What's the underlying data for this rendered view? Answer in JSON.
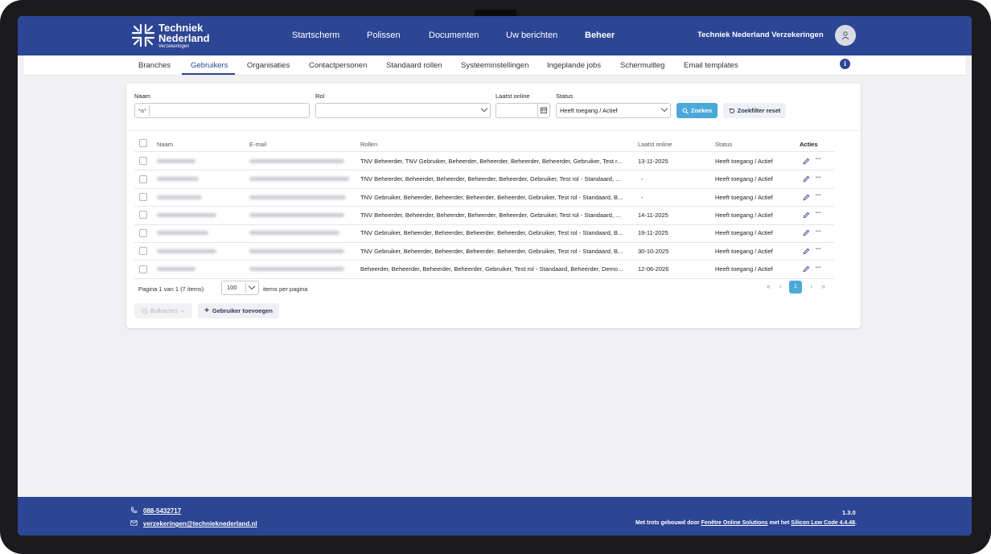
{
  "brand": {
    "line1": "Techniek",
    "line2": "Nederland",
    "line3": "Verzekeringen"
  },
  "mainnav": [
    "Startscherm",
    "Polissen",
    "Documenten",
    "Uw berichten",
    "Beheer"
  ],
  "org_name": "Techniek Nederland Verzekeringen",
  "subnav": [
    "Branches",
    "Gebruikers",
    "Organisaties",
    "Contactpersonen",
    "Standaard rollen",
    "Systeeminstellingen",
    "Ingeplande jobs",
    "Schermuitleg",
    "Email templates"
  ],
  "filters": {
    "naam_label": "Naam",
    "naam_value": "*a*",
    "rol_label": "Rol",
    "laatst_label": "Laatst online",
    "status_label": "Status",
    "status_value": "Heeft toegang / Actief",
    "search_label": "Zoeken",
    "reset_label": "Zoekfilter reset"
  },
  "table": {
    "headers": [
      "Naam",
      "E-mail",
      "Rollen",
      "Laatst online",
      "Status",
      "Acties"
    ],
    "rows": [
      {
        "rollen": "TNV Beheerder, TNV Gebruiker, Beheerder, Beheerder, Beheerder, Beheerder, Gebruiker, Test r...",
        "laatst": "13-11-2025",
        "status": "Heeft toegang / Actief"
      },
      {
        "rollen": "TNV Beheerder, Beheerder, Beheerder, Beheerder, Beheerder, Gebruiker, Test rol - Standaard, ...",
        "laatst": "-",
        "status": "Heeft toegang / Actief"
      },
      {
        "rollen": "TNV Gebruiker, Beheerder, Beheerder, Beheerder, Beheerder, Gebruiker, Test rol - Standaard, B...",
        "laatst": "-",
        "status": "Heeft toegang / Actief"
      },
      {
        "rollen": "TNV Beheerder, Beheerder, Beheerder, Beheerder, Beheerder, Gebruiker, Test rol - Standaard, ...",
        "laatst": "14-11-2025",
        "status": "Heeft toegang / Actief"
      },
      {
        "rollen": "TNV Gebruiker, Beheerder, Beheerder, Beheerder, Beheerder, Gebruiker, Test rol - Standaard, B...",
        "laatst": "19-11-2025",
        "status": "Heeft toegang / Actief"
      },
      {
        "rollen": "TNV Gebruiker, Beheerder, Beheerder, Beheerder, Beheerder, Gebruiker, Test rol - Standaard, B...",
        "laatst": "30-10-2025",
        "status": "Heeft toegang / Actief"
      },
      {
        "rollen": "Beheerder, Beheerder, Beheerder, Beheerder, Gebruiker, Test rol - Standaard, Beheerder, Demo...",
        "laatst": "12-06-2026",
        "status": "Heeft toegang / Actief"
      }
    ]
  },
  "pager": {
    "info": "Pagina 1 van 1 (7 items)",
    "per_page": "100",
    "per_page_label": "items per pagina",
    "current": "1"
  },
  "actions": {
    "bulk": "Bulkacties",
    "add": "Gebruiker toevoegen"
  },
  "footer": {
    "phone": "088-5432717",
    "email": "verzekeringen@technieknederland.nl",
    "version": "1.3.0",
    "built_prefix": "Met trots gebouwd door ",
    "built_company": "Fenêtre Online Solutions",
    "built_mid": " met het ",
    "built_platform": "Silicon Low Code 4.4.48",
    "built_suffix": "."
  },
  "colors": {
    "brand": "#2c4595",
    "accent": "#4ba9d9"
  }
}
